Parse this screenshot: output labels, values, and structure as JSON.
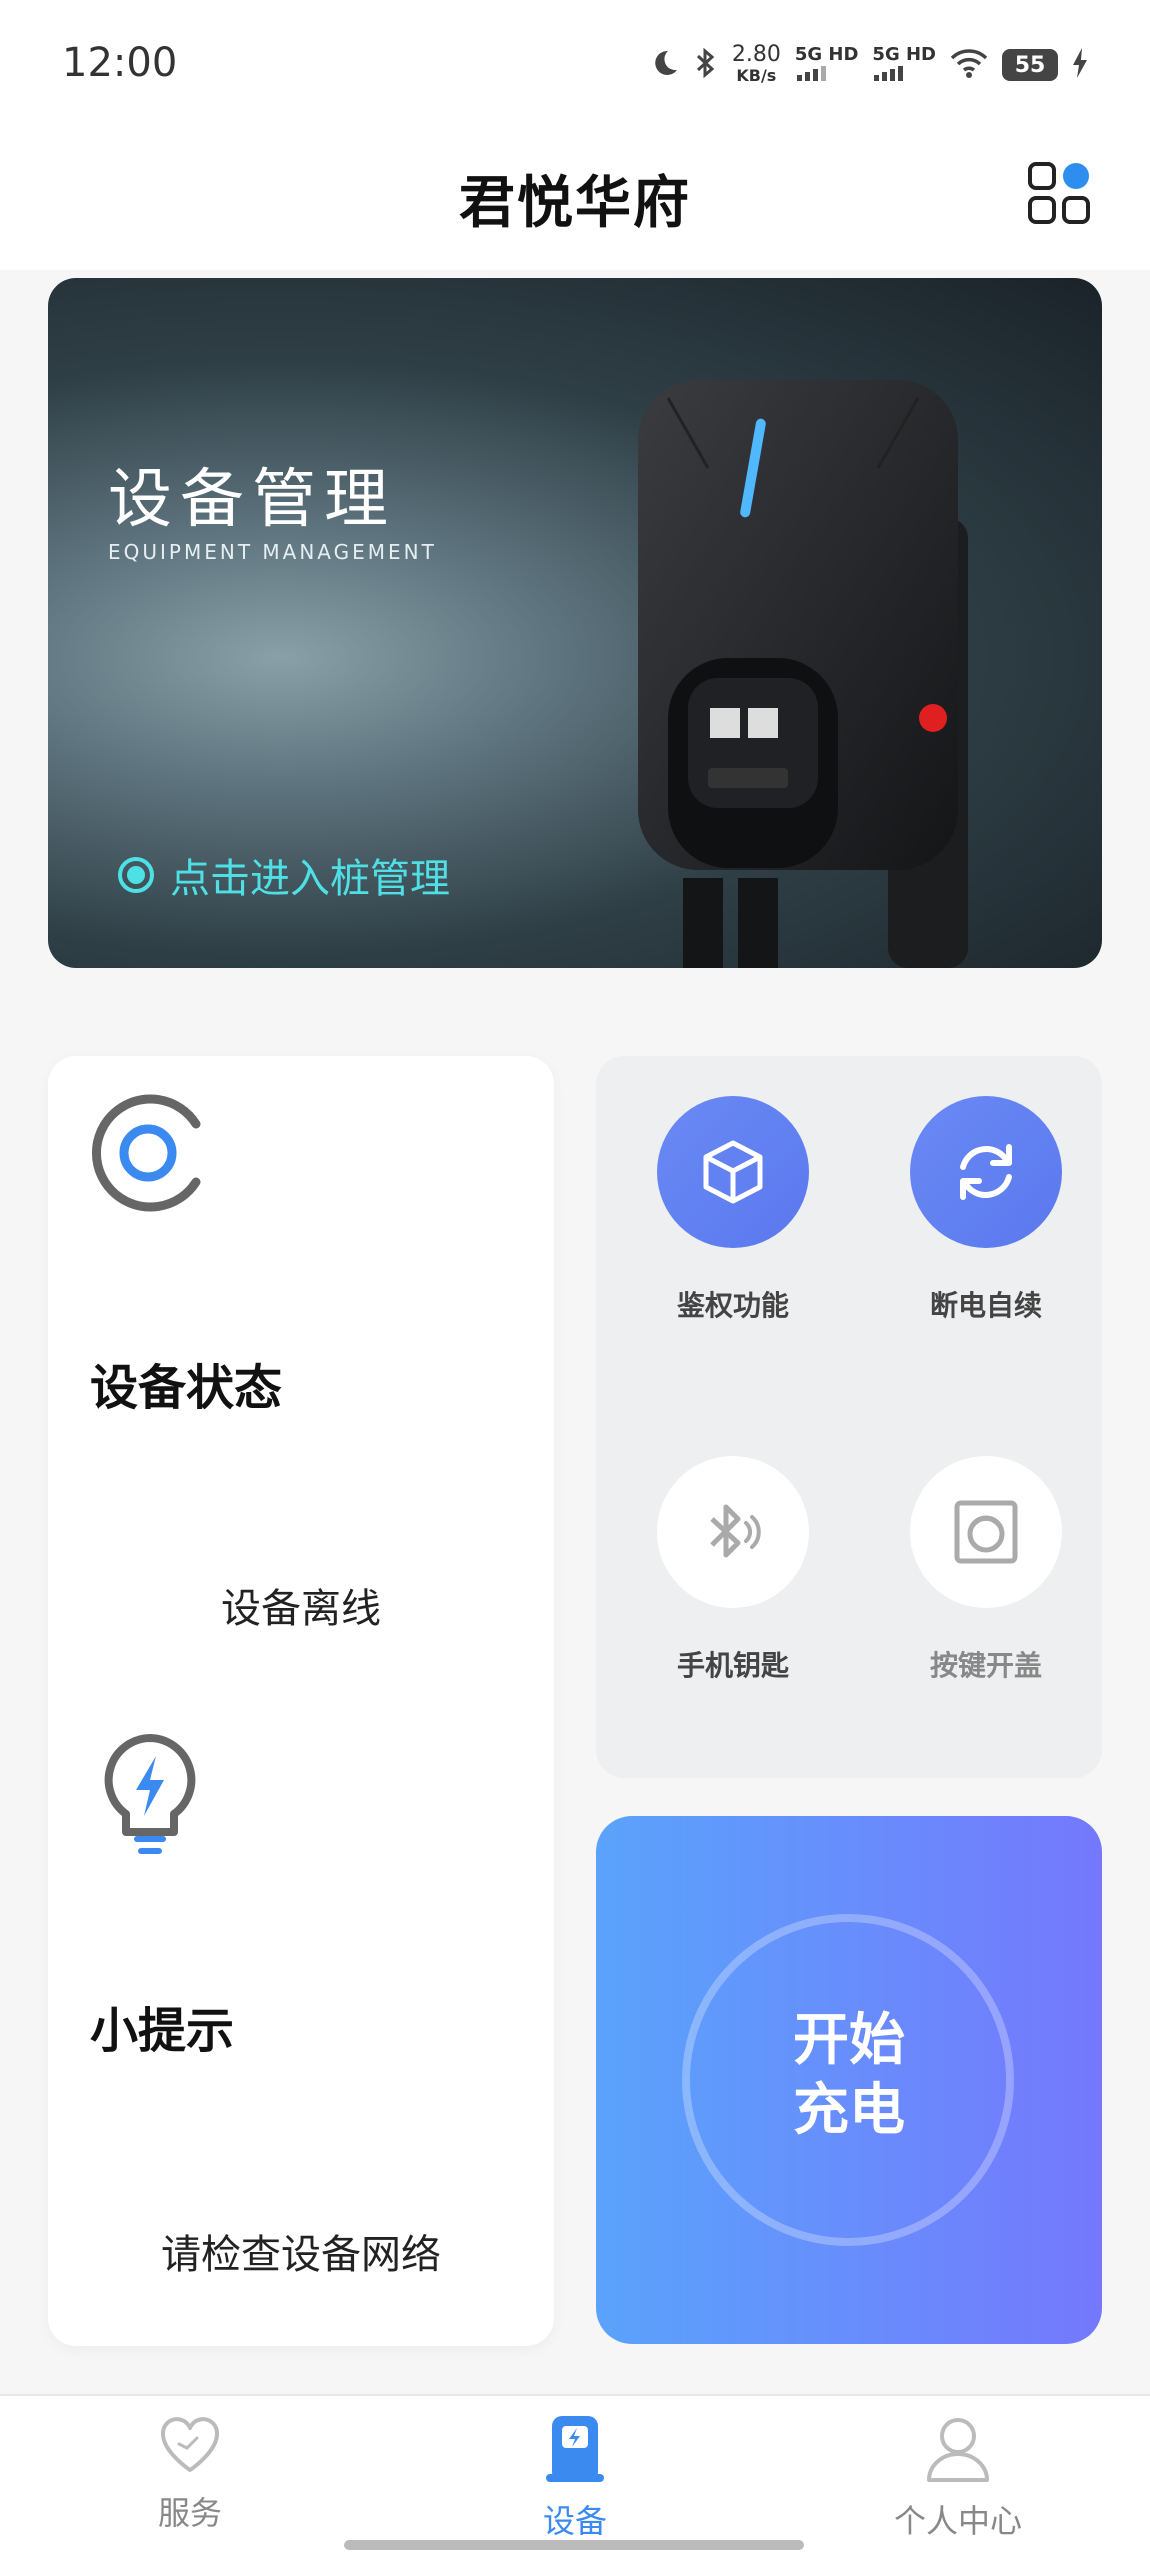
{
  "status_bar": {
    "time": "12:00",
    "net_speed": "2.80",
    "net_unit": "KB/s",
    "sim1": "5G HD",
    "sim2": "5G HD",
    "battery": "55"
  },
  "header": {
    "title": "君悦华府",
    "menu_icon": "grid-menu-icon"
  },
  "banner": {
    "title": "设备管理",
    "subtitle": "EQUIPMENT MANAGEMENT",
    "link_label": "点击进入桩管理"
  },
  "status_card": {
    "title": "设备状态",
    "value": "设备离线",
    "tip_title": "小提示",
    "tip_value": "请检查设备网络"
  },
  "functions": [
    {
      "label": "鉴权功能",
      "icon": "cube-icon",
      "active": true
    },
    {
      "label": "断电自续",
      "icon": "refresh-icon",
      "active": true
    },
    {
      "label": "手机钥匙",
      "icon": "bluetooth-icon",
      "active": false
    },
    {
      "label": "按键开盖",
      "icon": "button-icon",
      "active": false
    }
  ],
  "start_button": {
    "line1": "开始",
    "line2": "充电"
  },
  "bottom_nav": [
    {
      "label": "服务",
      "icon": "heart-icon",
      "active": false
    },
    {
      "label": "设备",
      "icon": "charger-icon",
      "active": true
    },
    {
      "label": "个人中心",
      "icon": "user-icon",
      "active": false
    }
  ],
  "colors": {
    "accent": "#3b8af0",
    "banner_link": "#4fe0e6",
    "start_gradient_from": "#5aa3fb",
    "start_gradient_to": "#7578fc"
  }
}
